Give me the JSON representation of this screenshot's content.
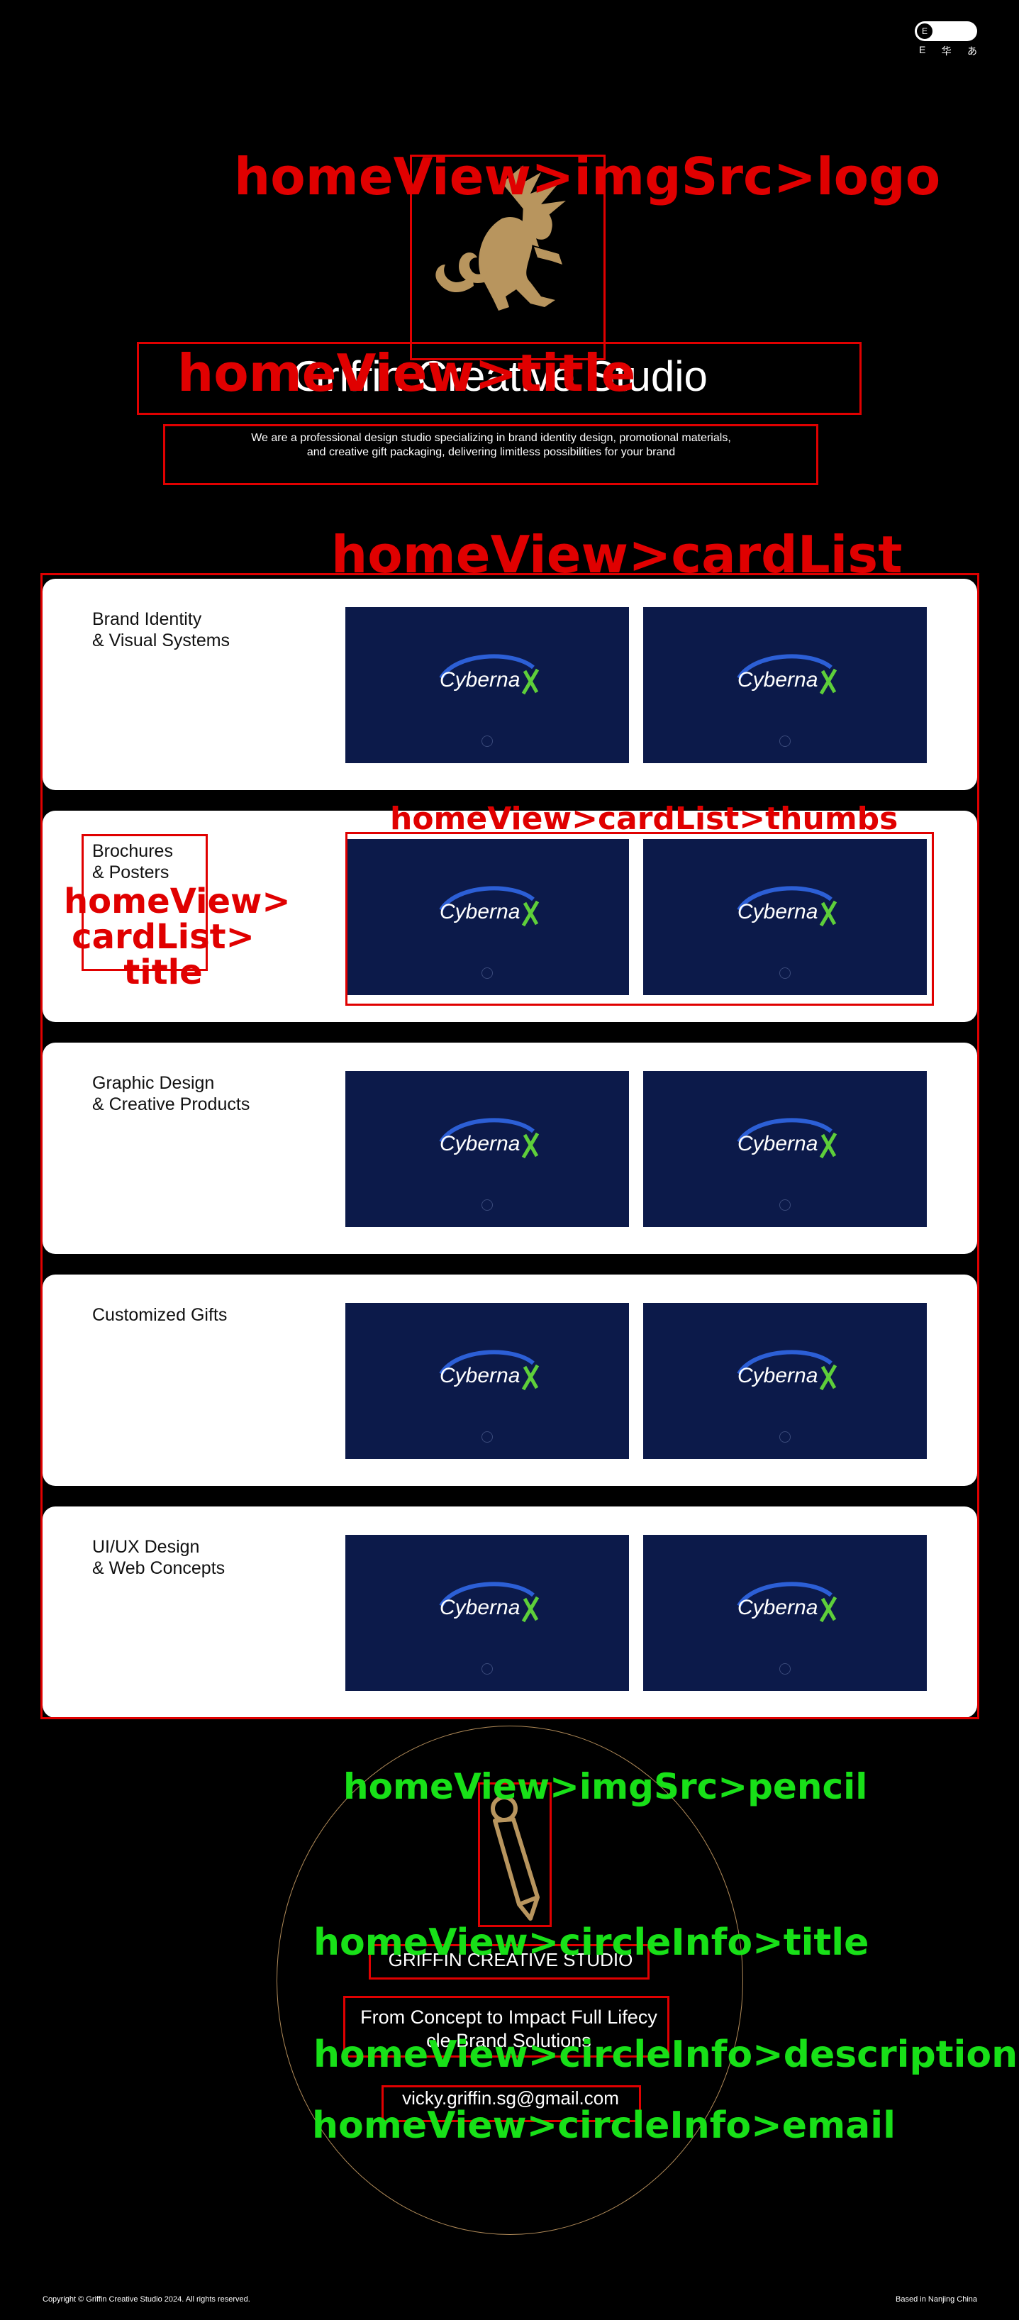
{
  "lang": {
    "current": "E",
    "options": [
      "E",
      "华",
      "あ"
    ]
  },
  "header": {
    "title": "Griffin Creative Studio",
    "description_line1": "We are a professional design studio specializing in brand identity design, promotional materials,",
    "description_line2": "and creative gift packaging, delivering limitless possibilities for your brand"
  },
  "cards": [
    {
      "title": "Brand Identity\n& Visual Systems",
      "thumbs": [
        {
          "brand": "Cyberna"
        },
        {
          "brand": "Cyberna"
        }
      ]
    },
    {
      "title": "Brochures\n& Posters",
      "thumbs": [
        {
          "brand": "Cyberna"
        },
        {
          "brand": "Cyberna"
        }
      ]
    },
    {
      "title": "Graphic Design\n& Creative Products",
      "thumbs": [
        {
          "brand": "Cyberna"
        },
        {
          "brand": "Cyberna"
        }
      ]
    },
    {
      "title": "Customized Gifts",
      "thumbs": [
        {
          "brand": "Cyberna"
        },
        {
          "brand": "Cyberna"
        }
      ]
    },
    {
      "title": "UI/UX Design\n& Web Concepts",
      "thumbs": [
        {
          "brand": "Cyberna"
        },
        {
          "brand": "Cyberna"
        }
      ]
    }
  ],
  "circle_info": {
    "title": "GRIFFIN CREATIVE STUDIO",
    "description_line1": "From Concept to Impact Full Lifecy",
    "description_line2": "cle Brand Solutions",
    "email": "vicky.griffin.sg@gmail.com"
  },
  "footer": {
    "copyright": "Copyright © Griffin Creative Studio 2024. All rights reserved.",
    "location": "Based in Nanjing China"
  },
  "annotations": {
    "logo": "homeView>imgSrc>logo",
    "title": "homeView>title",
    "card_list": "homeView>cardList",
    "thumbs": "homeView>cardList>thumbs",
    "card_title_1": "homeView>",
    "card_title_2": "cardList>",
    "card_title_3": "title",
    "pencil": "homeView>imgSrc>pencil",
    "circle_title": "homeView>circleInfo>title",
    "circle_description": "homeView>circleInfo>description",
    "circle_email": "homeView>circleInfo>email"
  },
  "colors": {
    "background": "#000000",
    "card": "#ffffff",
    "thumb": "#0c1a4a",
    "gold": "#b8955e",
    "annotation_red": "#e00000",
    "annotation_green": "#18e018"
  }
}
